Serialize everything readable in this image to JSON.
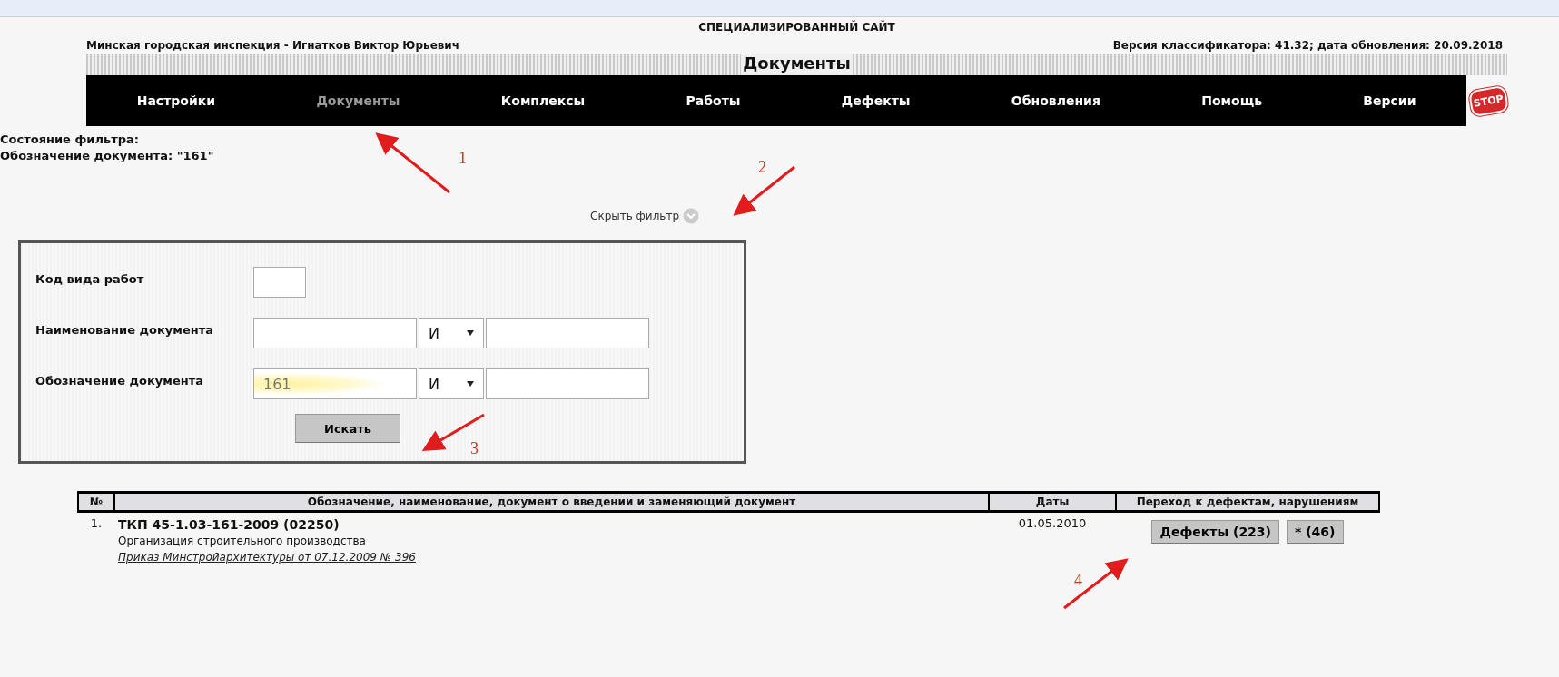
{
  "header": {
    "site_title": "СПЕЦИАЛИЗИРОВАННЫЙ САЙТ",
    "user": "Минская городская инспекция - Игнатков Виктор Юрьевич",
    "version_info": "Версия классификатора: 41.32; дата обновления: 20.09.2018",
    "page_title": "Документы"
  },
  "nav": [
    {
      "label": "Настройки",
      "selected": false
    },
    {
      "label": "Документы",
      "selected": true
    },
    {
      "label": "Комплексы",
      "selected": false
    },
    {
      "label": "Работы",
      "selected": false
    },
    {
      "label": "Дефекты",
      "selected": false
    },
    {
      "label": "Обновления",
      "selected": false
    },
    {
      "label": "Помощь",
      "selected": false
    },
    {
      "label": "Версии",
      "selected": false
    }
  ],
  "stop_label": "STOP",
  "filter_state": {
    "title": "Состояние фильтра:",
    "value": "Обозначение документа: \"161\""
  },
  "hide_filter": "Скрыть фильтр",
  "filter": {
    "rows": [
      {
        "kind": "code",
        "label": "Код вида работ",
        "value": ""
      },
      {
        "kind": "pair",
        "label": "Наименование документа",
        "value": "",
        "operator": "И",
        "value2": "",
        "highlighted": false
      },
      {
        "kind": "pair",
        "label": "Обозначение документа",
        "value": "161",
        "operator": "И",
        "value2": "",
        "highlighted": true
      }
    ],
    "search_button": "Искать"
  },
  "table": {
    "columns": [
      "№",
      "Обозначение, наименование, документ о введении и заменяющий документ",
      "Даты",
      "Переход к дефектам, нарушениям"
    ],
    "rows": [
      {
        "number": "1.",
        "designation": "ТКП 45-1.03-161-2009 (02250)",
        "name": "Организация строительного производства",
        "order_link": "Приказ Минстройархитектуры от 07.12.2009 № 396",
        "date": "01.05.2010",
        "buttons": [
          "Дефекты (223)",
          "* (46)"
        ]
      }
    ]
  },
  "annotations": [
    "1",
    "2",
    "3",
    "4"
  ]
}
